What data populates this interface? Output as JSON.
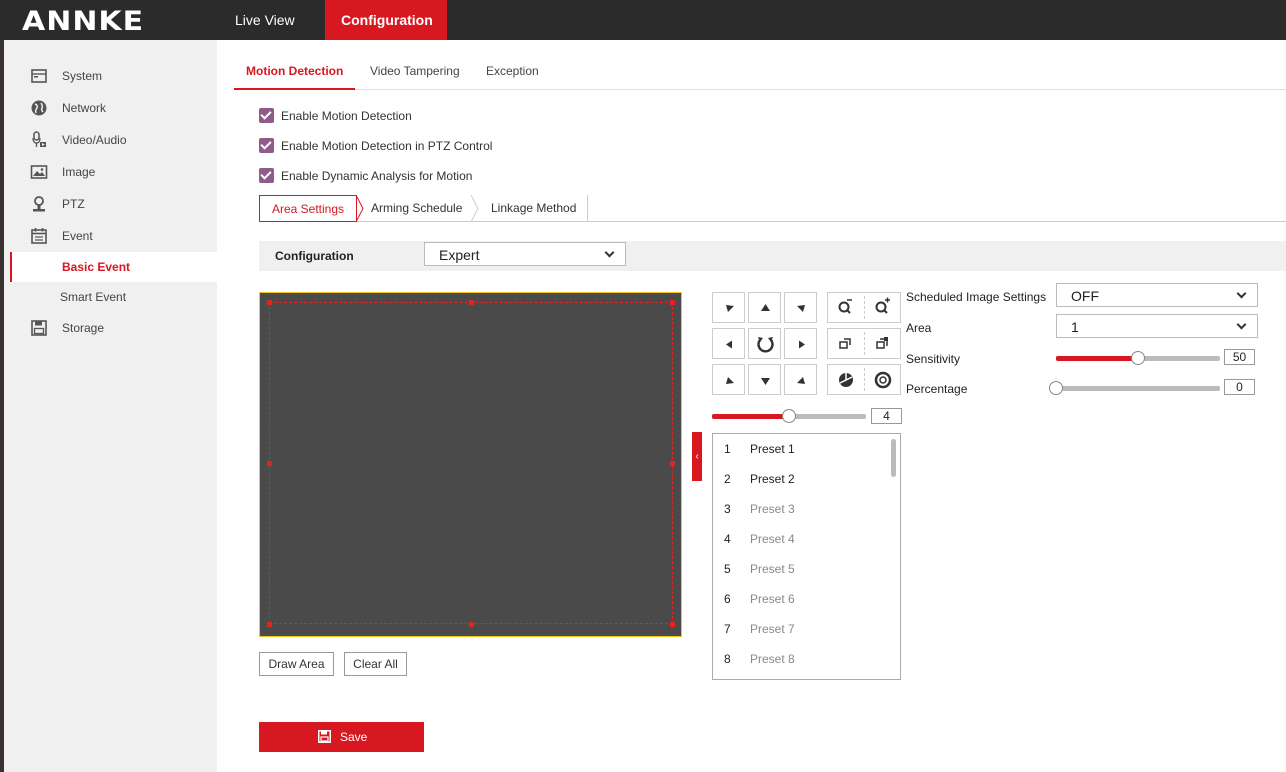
{
  "brand": {
    "logo": "ANNKE"
  },
  "topnav": {
    "live_view": "Live View",
    "configuration": "Configuration"
  },
  "sidebar": {
    "items": [
      {
        "label": "System",
        "icon": "monitor-icon"
      },
      {
        "label": "Network",
        "icon": "globe-icon"
      },
      {
        "label": "Video/Audio",
        "icon": "microphone-camera-icon"
      },
      {
        "label": "Image",
        "icon": "image-icon"
      },
      {
        "label": "PTZ",
        "icon": "ptz-camera-icon"
      },
      {
        "label": "Event",
        "icon": "calendar-icon"
      },
      {
        "label": "Storage",
        "icon": "floppy-disk-icon"
      }
    ],
    "event_sub": {
      "basic_event": "Basic Event",
      "smart_event": "Smart Event"
    }
  },
  "tabs": {
    "motion_detection": "Motion Detection",
    "video_tampering": "Video Tampering",
    "exception": "Exception"
  },
  "checkboxes": {
    "enable_motion": {
      "label": "Enable Motion Detection",
      "checked": true
    },
    "enable_ptz": {
      "label": "Enable Motion Detection in PTZ Control",
      "checked": true
    },
    "enable_dynamic": {
      "label": "Enable Dynamic Analysis for Motion",
      "checked": true
    }
  },
  "subtabs": {
    "area_settings": "Area Settings",
    "arming_schedule": "Arming Schedule",
    "linkage_method": "Linkage Method"
  },
  "config": {
    "label": "Configuration",
    "value": "Expert"
  },
  "buttons": {
    "draw_area": "Draw Area",
    "clear_all": "Clear All",
    "save": "Save"
  },
  "ptz": {
    "speed_value": "4",
    "speed_fraction": 0.5
  },
  "presets": [
    {
      "num": "1",
      "name": "Preset 1",
      "set": true
    },
    {
      "num": "2",
      "name": "Preset 2",
      "set": true
    },
    {
      "num": "3",
      "name": "Preset 3",
      "set": false
    },
    {
      "num": "4",
      "name": "Preset 4",
      "set": false
    },
    {
      "num": "5",
      "name": "Preset 5",
      "set": false
    },
    {
      "num": "6",
      "name": "Preset 6",
      "set": false
    },
    {
      "num": "7",
      "name": "Preset 7",
      "set": false
    },
    {
      "num": "8",
      "name": "Preset 8",
      "set": false
    }
  ],
  "settings": {
    "scheduled_label": "Scheduled Image Settings",
    "scheduled_value": "OFF",
    "area_label": "Area",
    "area_value": "1",
    "sensitivity_label": "Sensitivity",
    "sensitivity_value": "50",
    "sensitivity_fraction": 0.5,
    "percentage_label": "Percentage",
    "percentage_value": "0",
    "percentage_fraction": 0
  },
  "colors": {
    "accent": "#d71820",
    "checkbox": "#8e5b8a",
    "topbar": "#2b2b2b"
  }
}
